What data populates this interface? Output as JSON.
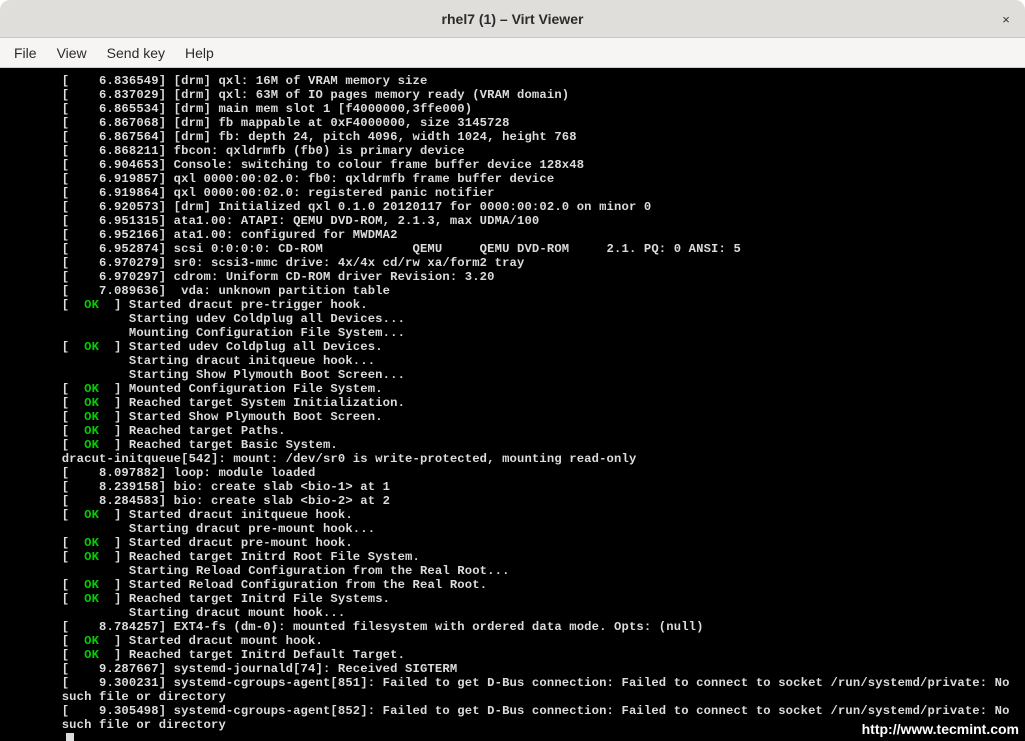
{
  "window": {
    "title": "rhel7 (1) – Virt Viewer",
    "close_glyph": "×"
  },
  "menu": {
    "file": "File",
    "view": "View",
    "send_key": "Send key",
    "help": "Help"
  },
  "console": {
    "ok_label": "OK",
    "lines": [
      {
        "t": "ts",
        "ts": "6.836549",
        "msg": "[drm] qxl: 16M of VRAM memory size"
      },
      {
        "t": "ts",
        "ts": "6.837029",
        "msg": "[drm] qxl: 63M of IO pages memory ready (VRAM domain)"
      },
      {
        "t": "ts",
        "ts": "6.865534",
        "msg": "[drm] main mem slot 1 [f4000000,3ffe000)"
      },
      {
        "t": "ts",
        "ts": "6.867068",
        "msg": "[drm] fb mappable at 0xF4000000, size 3145728"
      },
      {
        "t": "ts",
        "ts": "6.867564",
        "msg": "[drm] fb: depth 24, pitch 4096, width 1024, height 768"
      },
      {
        "t": "ts",
        "ts": "6.868211",
        "msg": "fbcon: qxldrmfb (fb0) is primary device"
      },
      {
        "t": "ts",
        "ts": "6.904653",
        "msg": "Console: switching to colour frame buffer device 128x48"
      },
      {
        "t": "ts",
        "ts": "6.919857",
        "msg": "qxl 0000:00:02.0: fb0: qxldrmfb frame buffer device"
      },
      {
        "t": "ts",
        "ts": "6.919864",
        "msg": "qxl 0000:00:02.0: registered panic notifier"
      },
      {
        "t": "ts",
        "ts": "6.920573",
        "msg": "[drm] Initialized qxl 0.1.0 20120117 for 0000:00:02.0 on minor 0"
      },
      {
        "t": "ts",
        "ts": "6.951315",
        "msg": "ata1.00: ATAPI: QEMU DVD-ROM, 2.1.3, max UDMA/100"
      },
      {
        "t": "ts",
        "ts": "6.952166",
        "msg": "ata1.00: configured for MWDMA2"
      },
      {
        "t": "ts",
        "ts": "6.952874",
        "msg": "scsi 0:0:0:0: CD-ROM            QEMU     QEMU DVD-ROM     2.1. PQ: 0 ANSI: 5"
      },
      {
        "t": "ts",
        "ts": "6.970279",
        "msg": "sr0: scsi3-mmc drive: 4x/4x cd/rw xa/form2 tray"
      },
      {
        "t": "ts",
        "ts": "6.970297",
        "msg": "cdrom: Uniform CD-ROM driver Revision: 3.20"
      },
      {
        "t": "ts",
        "ts": "7.089636",
        "msg": " vda: unknown partition table"
      },
      {
        "t": "ok",
        "msg": "Started dracut pre-trigger hook."
      },
      {
        "t": "plain",
        "indent": 9,
        "msg": "Starting udev Coldplug all Devices..."
      },
      {
        "t": "plain",
        "indent": 9,
        "msg": "Mounting Configuration File System..."
      },
      {
        "t": "ok",
        "msg": "Started udev Coldplug all Devices."
      },
      {
        "t": "plain",
        "indent": 9,
        "msg": "Starting dracut initqueue hook..."
      },
      {
        "t": "plain",
        "indent": 9,
        "msg": "Starting Show Plymouth Boot Screen..."
      },
      {
        "t": "ok",
        "msg": "Mounted Configuration File System."
      },
      {
        "t": "ok",
        "msg": "Reached target System Initialization."
      },
      {
        "t": "ok",
        "msg": "Started Show Plymouth Boot Screen."
      },
      {
        "t": "ok",
        "msg": "Reached target Paths."
      },
      {
        "t": "ok",
        "msg": "Reached target Basic System."
      },
      {
        "t": "plain",
        "indent": 0,
        "msg": "dracut-initqueue[542]: mount: /dev/sr0 is write-protected, mounting read-only"
      },
      {
        "t": "ts",
        "ts": "8.097882",
        "msg": "loop: module loaded"
      },
      {
        "t": "ts",
        "ts": "8.239158",
        "msg": "bio: create slab <bio-1> at 1"
      },
      {
        "t": "ts",
        "ts": "8.284583",
        "msg": "bio: create slab <bio-2> at 2"
      },
      {
        "t": "ok",
        "msg": "Started dracut initqueue hook."
      },
      {
        "t": "plain",
        "indent": 9,
        "msg": "Starting dracut pre-mount hook..."
      },
      {
        "t": "ok",
        "msg": "Started dracut pre-mount hook."
      },
      {
        "t": "ok",
        "msg": "Reached target Initrd Root File System."
      },
      {
        "t": "plain",
        "indent": 9,
        "msg": "Starting Reload Configuration from the Real Root..."
      },
      {
        "t": "ok",
        "msg": "Started Reload Configuration from the Real Root."
      },
      {
        "t": "ok",
        "msg": "Reached target Initrd File Systems."
      },
      {
        "t": "plain",
        "indent": 9,
        "msg": "Starting dracut mount hook..."
      },
      {
        "t": "ts",
        "ts": "8.784257",
        "msg": "EXT4-fs (dm-0): mounted filesystem with ordered data mode. Opts: (null)"
      },
      {
        "t": "ok",
        "msg": "Started dracut mount hook."
      },
      {
        "t": "ok",
        "msg": "Reached target Initrd Default Target."
      },
      {
        "t": "ts",
        "ts": "9.287667",
        "msg": "systemd-journald[74]: Received SIGTERM"
      },
      {
        "t": "ts",
        "ts": "9.300231",
        "msg": "systemd-cgroups-agent[851]: Failed to get D-Bus connection: Failed to connect to socket /run/systemd/private: No"
      },
      {
        "t": "plain",
        "indent": 0,
        "msg": "such file or directory"
      },
      {
        "t": "ts",
        "ts": "9.305498",
        "msg": "systemd-cgroups-agent[852]: Failed to get D-Bus connection: Failed to connect to socket /run/systemd/private: No"
      },
      {
        "t": "plain",
        "indent": 0,
        "msg": "such file or directory"
      }
    ]
  },
  "watermark": "http://www.tecmint.com"
}
